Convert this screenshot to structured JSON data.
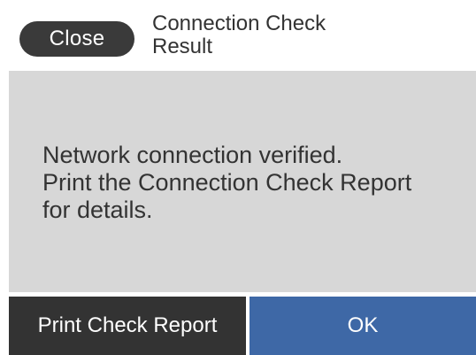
{
  "header": {
    "close_label": "Close",
    "title_line1": "Connection Check",
    "title_line2": "Result"
  },
  "message": {
    "line1": "Network connection verified.",
    "line2": "Print the Connection Check Report",
    "line3": "for details."
  },
  "footer": {
    "print_label": "Print Check Report",
    "ok_label": "OK"
  },
  "colors": {
    "close_button": "#3a3a3a",
    "body_background": "#d7d7d7",
    "print_button": "#333333",
    "ok_button": "#3e68a6"
  }
}
